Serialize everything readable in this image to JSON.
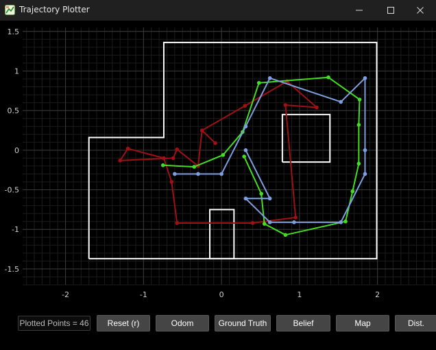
{
  "window": {
    "title": "Trajectory Plotter",
    "icon": "chart-app-icon",
    "controls": [
      "minimize-icon",
      "maximize-icon",
      "close-icon"
    ]
  },
  "plot": {
    "background": "#000000",
    "grid_color": "#3a3a3a",
    "axis_tick_color": "#cfcfcf",
    "x_ticks": [
      "-2",
      "-1",
      "0",
      "1",
      "2"
    ],
    "y_ticks": [
      "1.5",
      "1",
      "0.5",
      "0",
      "-0.5",
      "-1",
      "-1.5"
    ]
  },
  "chart_data": {
    "type": "line",
    "xlim": [
      -2.55,
      2.75
    ],
    "ylim": [
      -1.7,
      1.55
    ],
    "grid": true,
    "series": [
      {
        "color": "#a01014",
        "points": [
          [
            -0.08,
            0.09
          ],
          [
            -0.25,
            0.25
          ],
          [
            -0.3,
            -0.2
          ],
          [
            -0.57,
            0.01
          ],
          [
            -0.62,
            -0.1
          ],
          [
            -1.3,
            -0.13
          ],
          [
            -1.2,
            0.02
          ],
          [
            -0.74,
            -0.1
          ],
          [
            -0.64,
            -0.4
          ],
          [
            -0.57,
            -0.92
          ],
          [
            0.4,
            -0.92
          ],
          [
            0.95,
            -0.85
          ],
          [
            0.82,
            0.57
          ],
          [
            1.22,
            0.54
          ],
          [
            0.84,
            0.87
          ],
          [
            0.3,
            0.56
          ],
          [
            -0.25,
            0.25
          ]
        ]
      },
      {
        "color": "#44dd22",
        "points": [
          [
            -0.75,
            -0.19
          ],
          [
            -0.35,
            -0.21
          ],
          [
            0.02,
            -0.06
          ],
          [
            0.27,
            0.23
          ],
          [
            0.48,
            0.85
          ],
          [
            1.37,
            0.92
          ],
          [
            1.77,
            0.64
          ],
          [
            1.76,
            0.32
          ],
          [
            1.76,
            -0.17
          ],
          [
            1.68,
            -0.52
          ],
          [
            1.59,
            -0.9
          ],
          [
            0.82,
            -1.07
          ],
          [
            0.55,
            -0.93
          ],
          [
            0.51,
            -0.55
          ],
          [
            0.29,
            -0.08
          ]
        ]
      },
      {
        "color": "#7fa0e0",
        "points": [
          [
            -0.6,
            -0.3
          ],
          [
            -0.3,
            -0.3
          ],
          [
            0.0,
            -0.3
          ],
          [
            0.31,
            0.3
          ],
          [
            0.62,
            0.91
          ],
          [
            1.53,
            0.61
          ],
          [
            1.84,
            0.91
          ],
          [
            1.84,
            0.0
          ],
          [
            1.84,
            -0.3
          ],
          [
            1.53,
            -0.91
          ],
          [
            0.93,
            -0.91
          ],
          [
            0.62,
            -0.91
          ],
          [
            0.31,
            -0.61
          ],
          [
            0.62,
            -0.61
          ],
          [
            0.31,
            0.0
          ]
        ]
      }
    ],
    "map_outlines": [
      [
        [
          -1.7,
          -1.37
        ],
        [
          1.99,
          -1.37
        ],
        [
          1.99,
          1.36
        ],
        [
          -0.74,
          1.36
        ],
        [
          -0.74,
          0.16
        ],
        [
          -1.7,
          0.16
        ],
        [
          -1.7,
          -1.37
        ]
      ],
      [
        [
          0.78,
          -0.15
        ],
        [
          1.39,
          -0.15
        ],
        [
          1.39,
          0.45
        ],
        [
          0.78,
          0.45
        ],
        [
          0.78,
          -0.15
        ]
      ],
      [
        [
          -0.15,
          -1.37
        ],
        [
          0.16,
          -1.37
        ],
        [
          0.16,
          -0.75
        ],
        [
          -0.15,
          -0.75
        ],
        [
          -0.15,
          -1.37
        ]
      ]
    ],
    "map_color": "#ffffff"
  },
  "controls": {
    "plotted_points": "Plotted Points = 46",
    "reset": "Reset (r)",
    "odom": "Odom",
    "ground_truth": "Ground Truth",
    "belief": "Belief",
    "map": "Map",
    "dist": "Dist."
  }
}
